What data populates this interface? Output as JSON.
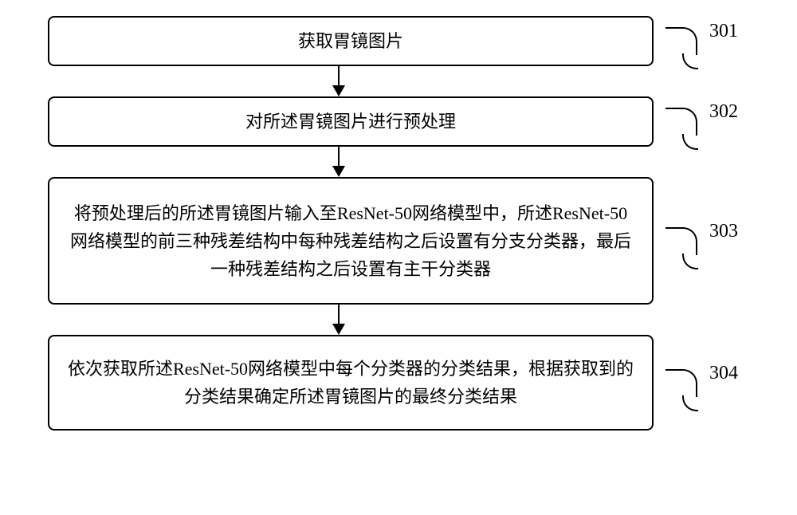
{
  "chart_data": {
    "type": "flowchart",
    "direction": "top-to-bottom",
    "steps": [
      {
        "id": "301",
        "text": "获取胃镜图片"
      },
      {
        "id": "302",
        "text": "对所述胃镜图片进行预处理"
      },
      {
        "id": "303",
        "text": "将预处理后的所述胃镜图片输入至ResNet-50网络模型中，所述ResNet-50网络模型的前三种残差结构中每种残差结构之后设置有分支分类器，最后一种残差结构之后设置有主干分类器"
      },
      {
        "id": "304",
        "text": "依次获取所述ResNet-50网络模型中每个分类器的分类结果，根据获取到的分类结果确定所述胃镜图片的最终分类结果"
      }
    ]
  },
  "steps": {
    "s1": {
      "label": "301",
      "text": "获取胃镜图片"
    },
    "s2": {
      "label": "302",
      "text": "对所述胃镜图片进行预处理"
    },
    "s3": {
      "label": "303",
      "text": "将预处理后的所述胃镜图片输入至ResNet-50网络模型中，所述ResNet-50网络模型的前三种残差结构中每种残差结构之后设置有分支分类器，最后一种残差结构之后设置有主干分类器"
    },
    "s4": {
      "label": "304",
      "text": "依次获取所述ResNet-50网络模型中每个分类器的分类结果，根据获取到的分类结果确定所述胃镜图片的最终分类结果"
    }
  }
}
